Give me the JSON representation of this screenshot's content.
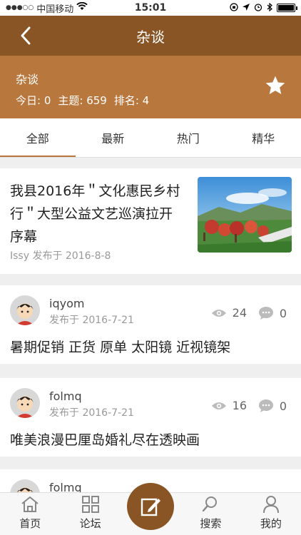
{
  "status_bar": {
    "signal": "●●●○○",
    "carrier": "中国移动",
    "time": "15:01"
  },
  "nav": {
    "title": "杂谈"
  },
  "forum": {
    "name": "杂谈",
    "today": "今日: 0",
    "topics": "主题: 659",
    "rank": "排名: 4"
  },
  "tabs": [
    {
      "label": "全部",
      "active": true
    },
    {
      "label": "最新",
      "active": false
    },
    {
      "label": "热门",
      "active": false
    },
    {
      "label": "精华",
      "active": false
    }
  ],
  "featured": {
    "title": "我县2016年＂文化惠民乡村行＂大型公益文艺巡演拉开序幕",
    "meta": "Issy 发布于 2016-8-8"
  },
  "posts": [
    {
      "user": "iqyom",
      "date": "发布于 2016-7-21",
      "views": "24",
      "replies": "0",
      "title": "暑期促销 正货 原单 太阳镜 近视镜架"
    },
    {
      "user": "folmq",
      "date": "发布于 2016-7-21",
      "views": "16",
      "replies": "0",
      "title": "唯美浪漫巴厘岛婚礼尽在透映画"
    },
    {
      "user": "folmq"
    }
  ],
  "tabbar": {
    "home": "首页",
    "forum": "论坛",
    "search": "搜索",
    "mine": "我的"
  },
  "colors": {
    "nav": "#8a5524",
    "header": "#b8773c"
  }
}
